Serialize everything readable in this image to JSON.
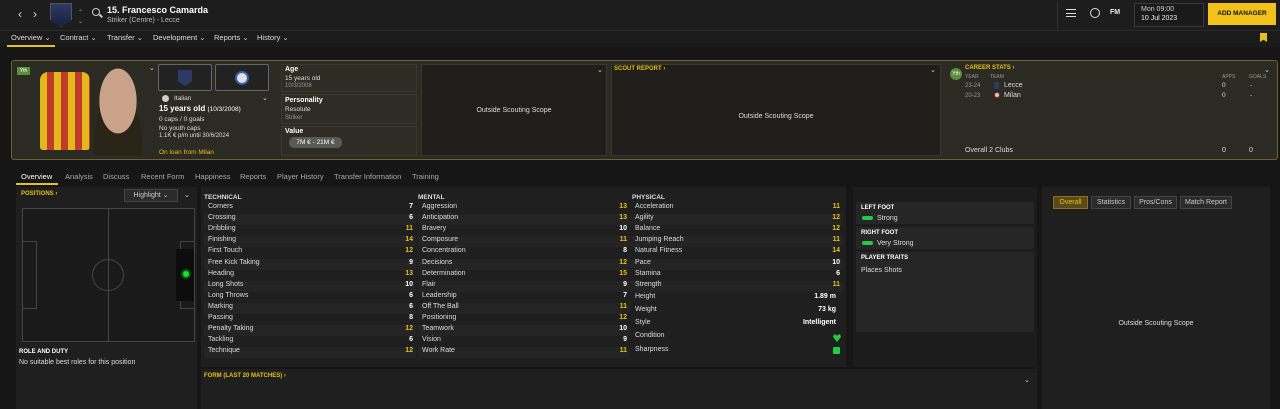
{
  "header": {
    "title": "15. Francesco Camarda",
    "subtitle": "Striker (Centre) - Lecce",
    "date_day": "Mon 09:00",
    "date": "10 Jul 2023",
    "add_manager": "ADD MANAGER",
    "fm": "FM"
  },
  "nav": [
    "Overview",
    "Contract",
    "Transfer",
    "Development",
    "Reports",
    "History"
  ],
  "profile": {
    "nationality": "Italian",
    "age_line": "15 years old",
    "dob_paren": "(10/3/2008)",
    "caps": "0 caps / 0 goals",
    "youth": "No youth caps",
    "wage": "1.1K € p/m until 30/6/2024",
    "loan": "On loan from Milan",
    "kit_tag": "Yth"
  },
  "info": {
    "age_label": "Age",
    "age_val": "15 years old",
    "dob": "10/3/2008",
    "pers_label": "Personality",
    "pers_val": "Resolute",
    "role": "Striker",
    "value_label": "Value",
    "value_val": "7M € - 21M €"
  },
  "scout": {
    "outside1": "Outside Scouting Scope",
    "report_label": "SCOUT REPORT",
    "outside2": "Outside Scouting Scope"
  },
  "career": {
    "label": "CAREER STATS",
    "year_h": "YEAR",
    "team_h": "TEAM",
    "apps_h": "APPS",
    "goals_h": "GOALS",
    "rows": [
      {
        "year": "23-24",
        "team": "Lecce",
        "apps": "0",
        "goals": "-"
      },
      {
        "year": "20-23",
        "team": "Milan",
        "apps": "0",
        "goals": "-"
      }
    ],
    "total_label": "Overall 2 Clubs",
    "total_apps": "0",
    "total_goals": "0",
    "tag": "Yth"
  },
  "tabs2": [
    "Overview",
    "Analysis",
    "Discuss",
    "Recent Form",
    "Happiness",
    "Reports",
    "Player History",
    "Transfer Information",
    "Training"
  ],
  "positions": {
    "label": "POSITIONS",
    "highlight": "Highlight",
    "role_label": "ROLE AND DUTY",
    "role_val": "No suitable best roles for this position"
  },
  "attributes": {
    "technical_label": "TECHNICAL",
    "mental_label": "MENTAL",
    "physical_label": "PHYSICAL",
    "technical": [
      [
        "Corners",
        "7"
      ],
      [
        "Crossing",
        "6"
      ],
      [
        "Dribbling",
        "11"
      ],
      [
        "Finishing",
        "14"
      ],
      [
        "First Touch",
        "12"
      ],
      [
        "Free Kick Taking",
        "9"
      ],
      [
        "Heading",
        "13"
      ],
      [
        "Long Shots",
        "10"
      ],
      [
        "Long Throws",
        "6"
      ],
      [
        "Marking",
        "6"
      ],
      [
        "Passing",
        "8"
      ],
      [
        "Penalty Taking",
        "12"
      ],
      [
        "Tackling",
        "6"
      ],
      [
        "Technique",
        "12"
      ]
    ],
    "mental": [
      [
        "Aggression",
        "13"
      ],
      [
        "Anticipation",
        "13"
      ],
      [
        "Bravery",
        "10"
      ],
      [
        "Composure",
        "11"
      ],
      [
        "Concentration",
        "8"
      ],
      [
        "Decisions",
        "12"
      ],
      [
        "Determination",
        "15"
      ],
      [
        "Flair",
        "9"
      ],
      [
        "Leadership",
        "7"
      ],
      [
        "Off The Ball",
        "11"
      ],
      [
        "Positioning",
        "12"
      ],
      [
        "Teamwork",
        "10"
      ],
      [
        "Vision",
        "9"
      ],
      [
        "Work Rate",
        "11"
      ]
    ],
    "physical": [
      [
        "Acceleration",
        "11"
      ],
      [
        "Agility",
        "12"
      ],
      [
        "Balance",
        "12"
      ],
      [
        "Jumping Reach",
        "11"
      ],
      [
        "Natural Fitness",
        "14"
      ],
      [
        "Pace",
        "10"
      ],
      [
        "Stamina",
        "6"
      ],
      [
        "Strength",
        "11"
      ]
    ],
    "extra": [
      [
        "Height",
        "1.89 m"
      ],
      [
        "Weight",
        "73 kg"
      ],
      [
        "Style",
        "Intelligent"
      ],
      [
        "Condition",
        ""
      ],
      [
        "Sharpness",
        ""
      ]
    ]
  },
  "feet": {
    "left_label": "LEFT FOOT",
    "left_val": "Strong",
    "right_label": "RIGHT FOOT",
    "right_val": "Very Strong",
    "traits_label": "PLAYER TRAITS",
    "traits_val": "Places Shots"
  },
  "right_tabs": [
    "Overall",
    "Statistics",
    "Pros/Cons",
    "Match Report"
  ],
  "right_outside": "Outside Scouting Scope",
  "form_label": "FORM (LAST 20 MATCHES)"
}
